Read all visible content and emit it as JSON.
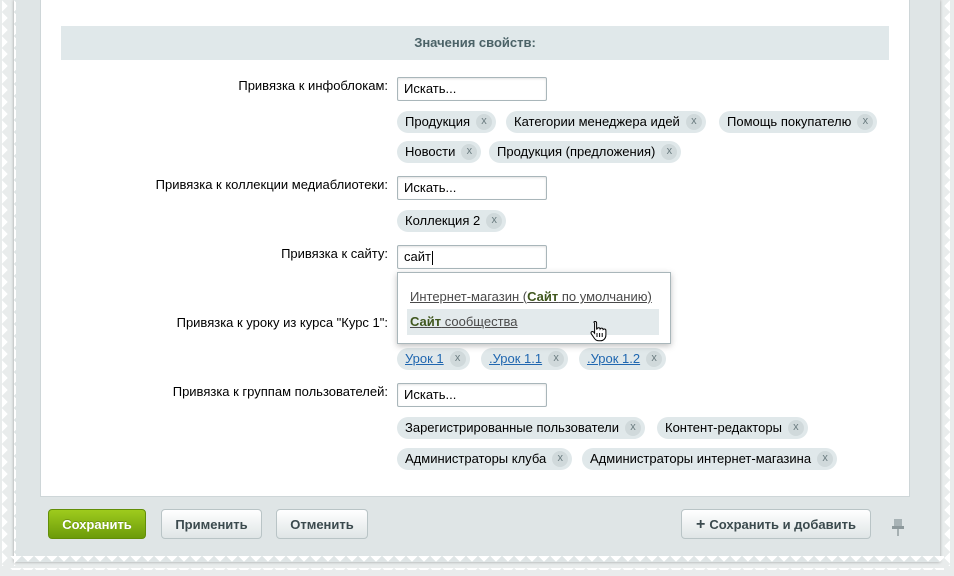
{
  "section": {
    "title": "Значения свойств:"
  },
  "fields": {
    "iblocks": {
      "label": "Привязка к инфоблокам:",
      "placeholder": "Искать...",
      "chips": [
        "Продукция",
        "Категории менеджера идей",
        "Помощь покупателю",
        "Новости",
        "Продукция (предложения)"
      ]
    },
    "media": {
      "label": "Привязка к коллекции медиаблиотеки:",
      "placeholder": "Искать...",
      "chips": [
        "Коллекция 2"
      ]
    },
    "site": {
      "label": "Привязка к сайту:",
      "value": "сайт",
      "suggestions": [
        {
          "prefix": "Интернет-магазин (",
          "match": "Сайт",
          "suffix": " по умолчанию)"
        },
        {
          "prefix": "",
          "match": "Сайт",
          "suffix": " сообщества"
        }
      ]
    },
    "lesson": {
      "label": "Привязка к уроку из курса \"Курс 1\":",
      "chips": [
        "Урок 1",
        ".Урок 1.1",
        ".Урок 1.2"
      ]
    },
    "groups": {
      "label": "Привязка к группам пользователей:",
      "placeholder": "Искать...",
      "chips": [
        "Зарегистрированные пользователи",
        "Контент-редакторы",
        "Администраторы клуба",
        "Администраторы интернет-магазина"
      ]
    }
  },
  "chip_remove": "x",
  "buttons": {
    "save": "Сохранить",
    "apply": "Применить",
    "cancel": "Отменить",
    "save_add": "Сохранить и добавить"
  },
  "colors": {
    "accent": "#7fb114",
    "link": "#2067b0",
    "match": "#40571e"
  }
}
